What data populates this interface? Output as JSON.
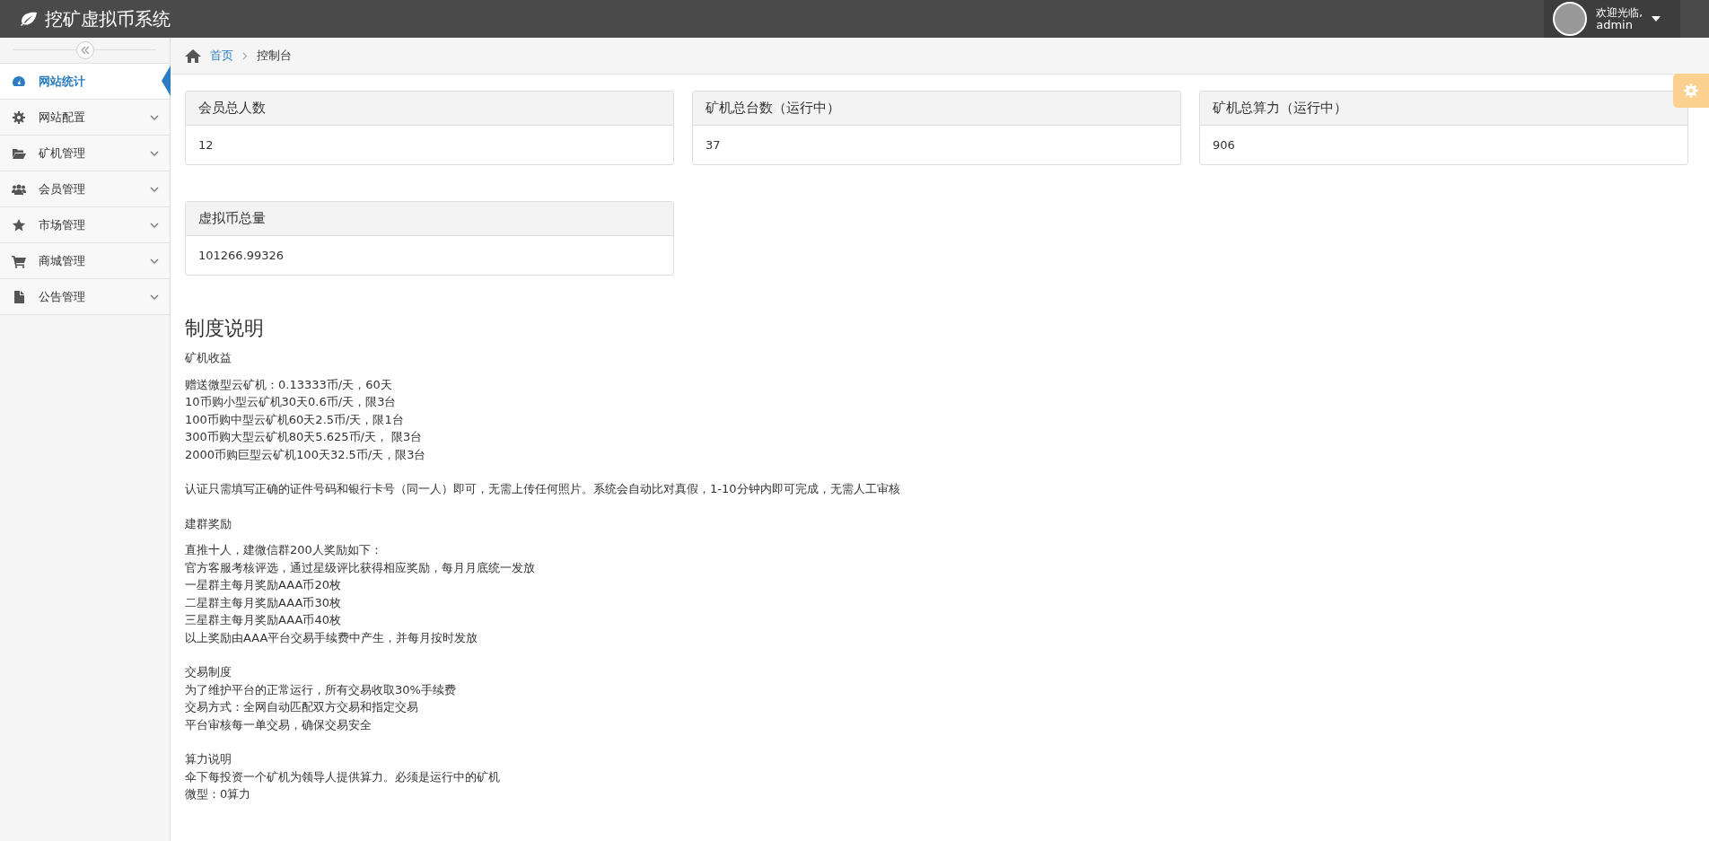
{
  "header": {
    "title": "挖矿虚拟币系统",
    "welcome": "欢迎光临,",
    "username": "admin"
  },
  "sidebar": {
    "items": [
      {
        "label": "网站统计",
        "selected": true,
        "has_submenu": false
      },
      {
        "label": "网站配置",
        "selected": false,
        "has_submenu": true
      },
      {
        "label": "矿机管理",
        "selected": false,
        "has_submenu": true
      },
      {
        "label": "会员管理",
        "selected": false,
        "has_submenu": true
      },
      {
        "label": "市场管理",
        "selected": false,
        "has_submenu": true
      },
      {
        "label": "商城管理",
        "selected": false,
        "has_submenu": true
      },
      {
        "label": "公告管理",
        "selected": false,
        "has_submenu": true
      }
    ]
  },
  "breadcrumb": [
    "首页",
    "控制台"
  ],
  "stat_cards": [
    {
      "title": "会员总人数",
      "value": "12"
    },
    {
      "title": "矿机总台数（运行中）",
      "value": "37"
    },
    {
      "title": "矿机总算力（运行中）",
      "value": "906"
    },
    {
      "title": "虚拟币总量",
      "value": "101266.99326"
    }
  ],
  "rules": {
    "title": "制度说明",
    "blocks": [
      {
        "kind": "label",
        "lines": [
          "矿机收益"
        ]
      },
      {
        "kind": "lines",
        "lines": [
          "赠送微型云矿机：0.13333币/天，60天",
          "10币购小型云矿机30天0.6币/天，限3台",
          "100币购中型云矿机60天2.5币/天，限1台",
          "300币购大型云矿机80天5.625币/天， 限3台",
          "2000币购巨型云矿机100天32.5币/天，限3台"
        ]
      },
      {
        "kind": "lines",
        "lines": [
          "认证只需填写正确的证件号码和银行卡号（同一人）即可，无需上传任何照片。系统会自动比对真假，1-10分钟内即可完成，无需人工审核"
        ]
      },
      {
        "kind": "label",
        "lines": [
          "建群奖励"
        ]
      },
      {
        "kind": "lines",
        "lines": [
          "直推十人，建微信群200人奖励如下：",
          "官方客服考核评选，通过星级评比获得相应奖励，每月月底统一发放",
          "一星群主每月奖励AAA币20枚",
          "二星群主每月奖励AAA币30枚",
          "三星群主每月奖励AAA币40枚",
          "以上奖励由AAA平台交易手续费中产生，并每月按时发放"
        ]
      },
      {
        "kind": "lines",
        "lines": [
          "交易制度",
          "为了维护平台的正常运行，所有交易收取30%手续费",
          "交易方式：全网自动匹配双方交易和指定交易",
          "平台审核每一单交易，确保交易安全"
        ]
      },
      {
        "kind": "lines",
        "lines": [
          "算力说明",
          "伞下每投资一个矿机为领导人提供算力。必须是运行中的矿机",
          "微型：0算力"
        ]
      }
    ]
  }
}
